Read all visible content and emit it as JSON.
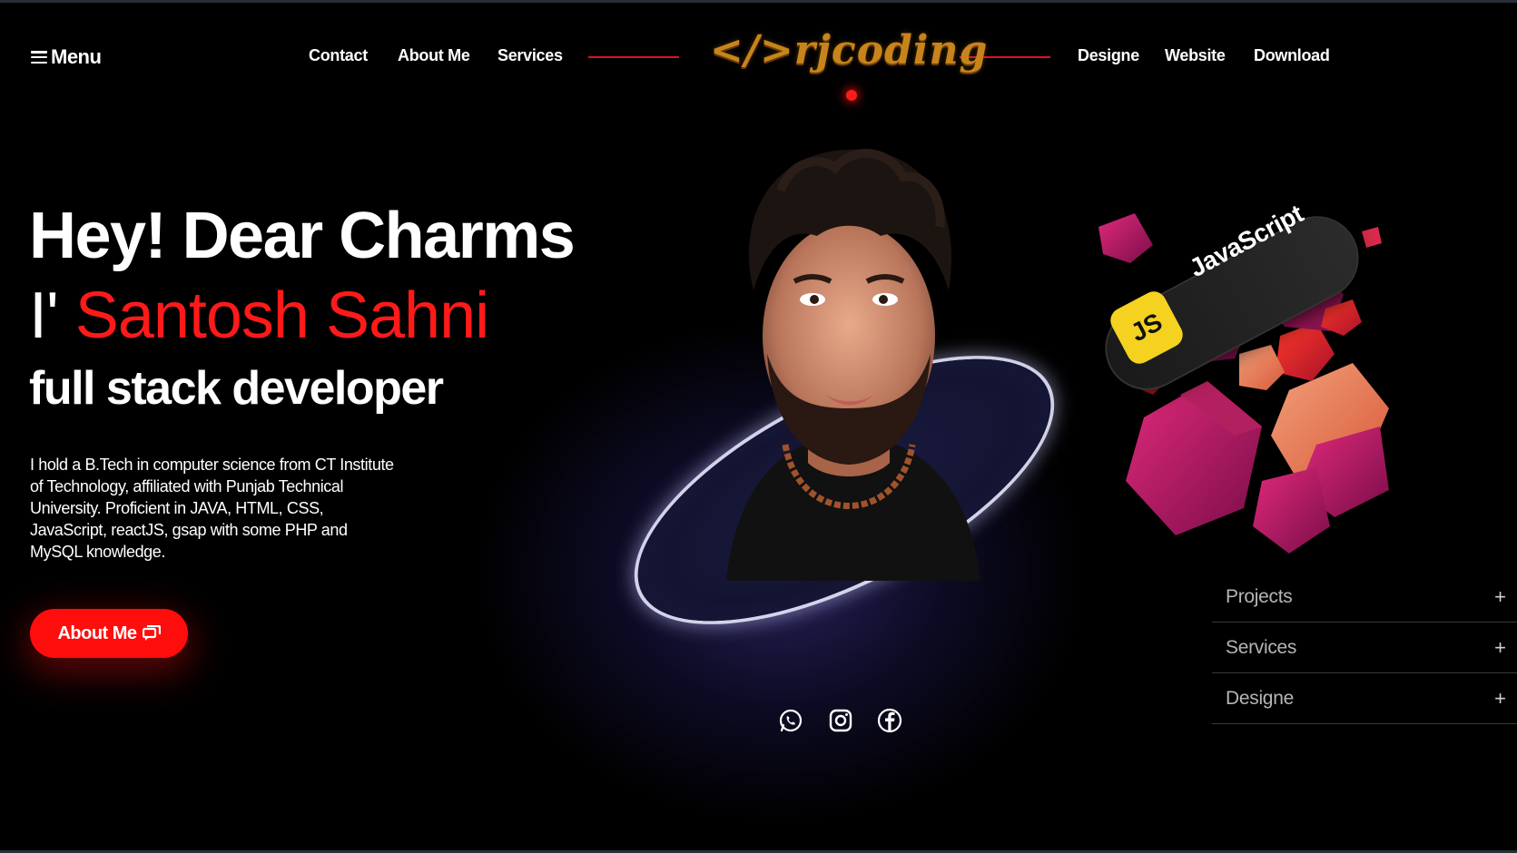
{
  "header": {
    "menu_label": "Menu",
    "nav_left": [
      "Contact",
      "About Me",
      "Services"
    ],
    "logo_text": "</>rjcoding",
    "nav_right": [
      "Designe",
      "Website",
      "Download"
    ]
  },
  "hero": {
    "greeting": "Hey! Dear Charms",
    "intro_prefix": "I'",
    "name": "Santosh Sahni",
    "role": "full stack developer",
    "bio": "I hold a B.Tech in computer science from CT Institute of Technology, affiliated with Punjab Technical University. Proficient in JAVA, HTML, CSS, JavaScript, reactJS, gsap with some PHP and MySQL knowledge.",
    "cta_label": "About Me"
  },
  "badge": {
    "js_short": "JS",
    "js_label": "JavaScript"
  },
  "accordion": {
    "items": [
      {
        "label": "Projects",
        "icon": "+"
      },
      {
        "label": "Services",
        "icon": "+"
      },
      {
        "label": "Designe",
        "icon": "+"
      }
    ]
  },
  "social": {
    "icons": [
      "whatsapp-icon",
      "instagram-icon",
      "facebook-icon"
    ]
  },
  "colors": {
    "accent": "#ff0d0d",
    "background": "#000000",
    "logo": "#c8841c",
    "js_yellow": "#f4d21f"
  }
}
